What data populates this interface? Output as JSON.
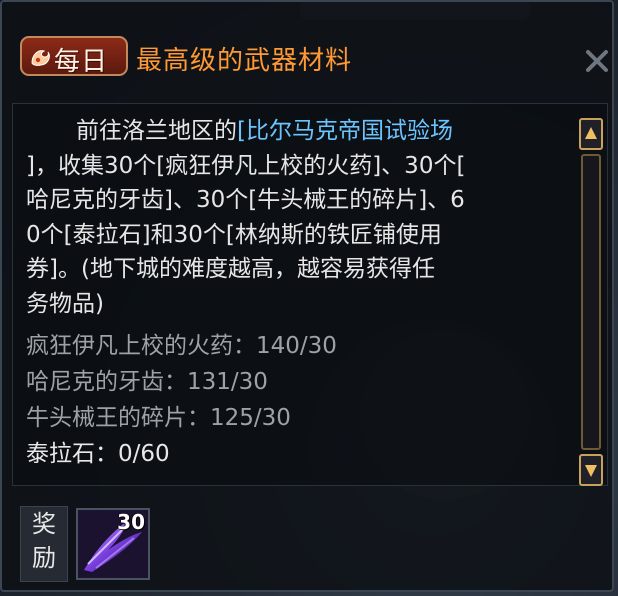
{
  "quest": {
    "badge_label": "每日",
    "title": "最高级的武器材料",
    "description": {
      "line1_prefix": "前往洛兰地区的",
      "line1_location": "[比尔马克帝国试验场",
      "line2": "]，收集30个[疯狂伊凡上校的火药]、30个[",
      "line3": "哈尼克的牙齿]、30个[牛头械王的碎片]、6",
      "line4": "0个[泰拉石]和30个[林纳斯的铁匠铺使用",
      "line5": "券]。(地下城的难度越高，越容易获得任",
      "line6": "务物品)"
    },
    "progress": [
      {
        "item": "疯狂伊凡上校的火药",
        "count": "140/30"
      },
      {
        "item": "哈尼克的牙齿",
        "count": "131/30"
      },
      {
        "item": "牛头械王的碎片",
        "count": "125/30"
      },
      {
        "item": "泰拉石",
        "count": "0/60"
      }
    ],
    "progress_separator": "：",
    "reward": {
      "label_char1": "奖",
      "label_char2": "励",
      "count": "30",
      "icon": "purple-material-icon"
    }
  },
  "colors": {
    "title": "#ff9933",
    "location": "#6cc4ff",
    "text": "#e6e6e6",
    "progress_done": "#9ea2a6",
    "badge": "#8d2a18"
  }
}
